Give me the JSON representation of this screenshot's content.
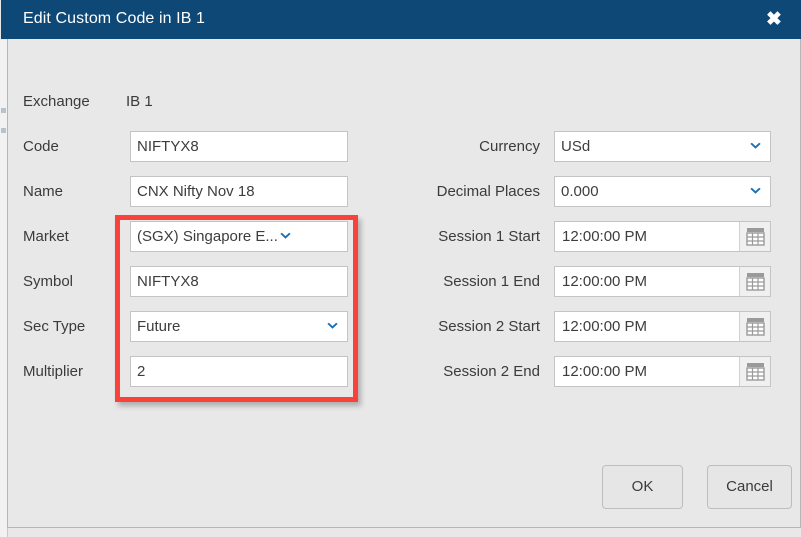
{
  "window": {
    "title": "Edit Custom Code in IB 1",
    "close_icon": "close-icon",
    "close_glyph": "✖",
    "titlebar_color": "#0e4876",
    "body_color": "#e8e8e8"
  },
  "exchange": {
    "label": "Exchange",
    "value": "IB 1"
  },
  "left_fields": [
    {
      "label": "Code",
      "value": "NIFTYX8",
      "type": "text"
    },
    {
      "label": "Name",
      "value": "CNX Nifty Nov 18",
      "type": "text"
    },
    {
      "label": "Market",
      "value": "(SGX) Singapore E...",
      "type": "select"
    },
    {
      "label": "Symbol",
      "value": "NIFTYX8",
      "type": "text"
    },
    {
      "label": "Sec Type",
      "value": "Future",
      "type": "select"
    },
    {
      "label": "Multiplier",
      "value": "2",
      "type": "text"
    }
  ],
  "right_fields": [
    {
      "label": "Currency",
      "value": "USd",
      "type": "select"
    },
    {
      "label": "Decimal Places",
      "value": "0.000",
      "type": "select"
    },
    {
      "label": "Session 1 Start",
      "value": "12:00:00 PM",
      "type": "time"
    },
    {
      "label": "Session 1 End",
      "value": "12:00:00 PM",
      "type": "time"
    },
    {
      "label": "Session 2 Start",
      "value": "12:00:00 PM",
      "type": "time"
    },
    {
      "label": "Session 2 End",
      "value": "12:00:00 PM",
      "type": "time"
    }
  ],
  "icons": {
    "chevron_down": "❯",
    "calendar": "calendar-icon"
  },
  "annotation": {
    "color": "#f9423a",
    "highlights": [
      "Market",
      "Symbol",
      "Sec Type",
      "Multiplier"
    ]
  },
  "footer": {
    "ok_label": "OK",
    "cancel_label": "Cancel"
  }
}
